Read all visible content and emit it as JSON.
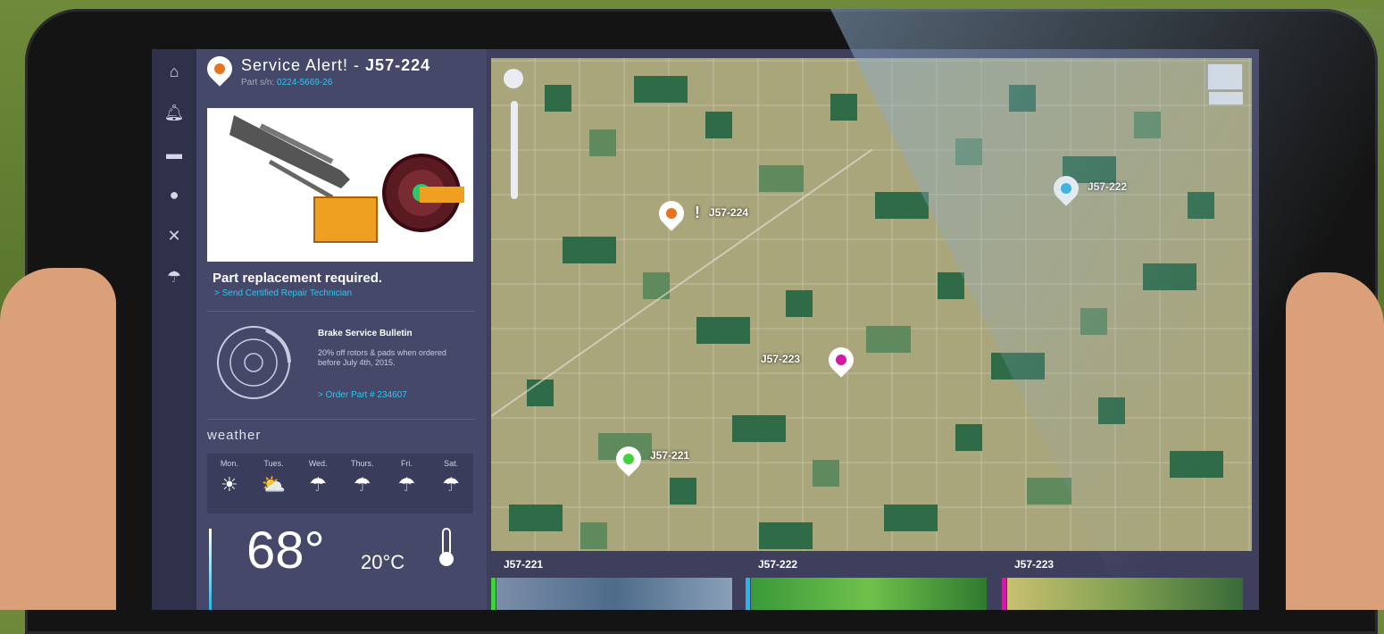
{
  "nav": {
    "icons": [
      "home-icon",
      "bell-icon",
      "calendar-icon",
      "globe-icon",
      "tools-icon",
      "umbrella-icon"
    ]
  },
  "alert": {
    "title_prefix": "Service Alert! - ",
    "title_id": "J57-224",
    "part_sn_label": "Part s/n:",
    "part_sn_value": "0224-5669-26",
    "replacement_text": "Part replacement required.",
    "repair_link": "> Send Certified Repair Technician",
    "pin_color": "#e8731f"
  },
  "bulletin": {
    "title": "Brake Service Bulletin",
    "text": "20% off rotors & pads when ordered before July 4th, 2015.",
    "link": "> Order Part # 234607"
  },
  "weather": {
    "label": "weather",
    "days": [
      {
        "name": "Mon.",
        "icon": "sun-icon",
        "glyph": "☀"
      },
      {
        "name": "Tues.",
        "icon": "partly-cloudy-icon",
        "glyph": "⛅"
      },
      {
        "name": "Wed.",
        "icon": "rain-icon",
        "glyph": "☂"
      },
      {
        "name": "Thurs.",
        "icon": "rain-icon",
        "glyph": "☂"
      },
      {
        "name": "Fri.",
        "icon": "rain-icon",
        "glyph": "☂"
      },
      {
        "name": "Sat.",
        "icon": "rain-icon",
        "glyph": "☂"
      }
    ],
    "temp_f": "68°",
    "temp_c": "20°C"
  },
  "map": {
    "markers": [
      {
        "id": "J57-224",
        "color": "#e8731f",
        "alert": "!"
      },
      {
        "id": "J57-222",
        "color": "#29b6e8"
      },
      {
        "id": "J57-223",
        "color": "#d11aa6"
      },
      {
        "id": "J57-221",
        "color": "#3fd23a"
      }
    ]
  },
  "thumbnails": [
    {
      "label": "J57-221",
      "color": "#3fd23a"
    },
    {
      "label": "J57-222",
      "color": "#29b6e8"
    },
    {
      "label": "J57-223",
      "color": "#d11aa6"
    }
  ]
}
